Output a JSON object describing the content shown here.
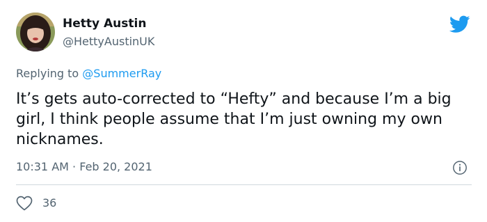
{
  "author": {
    "display_name": "Hetty Austin",
    "handle": "@HettyAustinUK"
  },
  "reply": {
    "prefix": "Replying to",
    "mention": "@SummerRay"
  },
  "tweet": {
    "text": "It’s gets auto-corrected to “Hefty” and because I’m a big girl, I think people assume that I’m just owning my own nicknames.",
    "time": "10:31 AM",
    "separator": "·",
    "date": "Feb 20, 2021"
  },
  "engagement": {
    "likes": "36"
  },
  "icons": {
    "brand": "twitter-bird-icon",
    "info": "info-icon",
    "like": "heart-icon"
  },
  "colors": {
    "brand_blue": "#1d9bf0",
    "text_primary": "#0f1419",
    "text_secondary": "#536471",
    "divider": "#cfd9de"
  }
}
